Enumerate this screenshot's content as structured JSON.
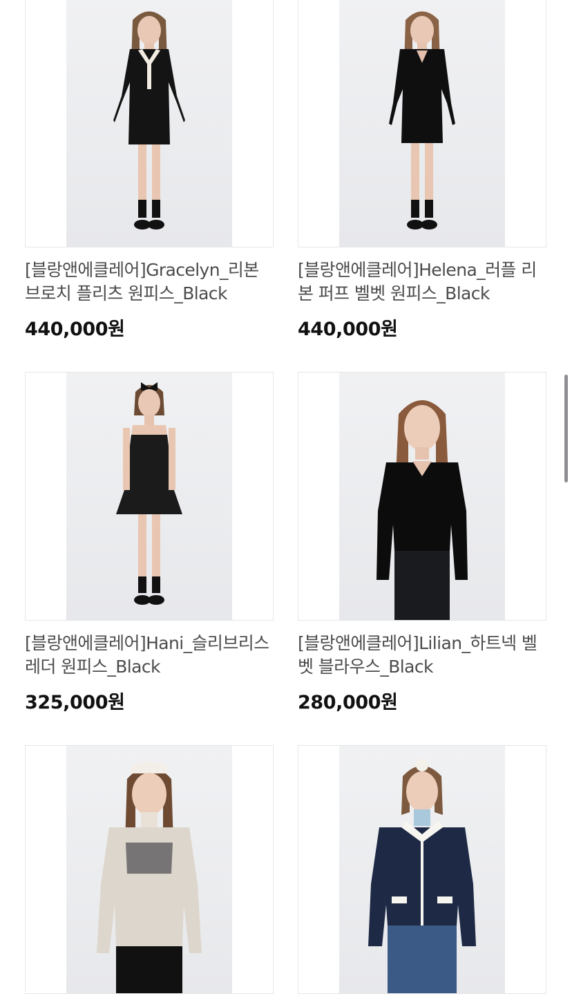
{
  "products": [
    {
      "name": "[블랑앤에클레어]Gracelyn_리본 브로치 플리츠 원피스_Black",
      "price": "440,000원",
      "image": "model-black-pleated-dress-with-ribbon-brooch"
    },
    {
      "name": "[블랑앤에클레어]Helena_러플 리본 퍼프 벨벳 원피스_Black",
      "price": "440,000원",
      "image": "model-black-velvet-puff-dress"
    },
    {
      "name": "[블랑앤에클레어]Hani_슬리브리스 레더 원피스_Black",
      "price": "325,000원",
      "image": "model-black-sleeveless-leather-dress"
    },
    {
      "name": "[블랑앤에클레어]Lilian_하트넥 벨벳 블라우스_Black",
      "price": "280,000원",
      "image": "model-black-heart-neck-velvet-blouse"
    },
    {
      "name": "",
      "price": "",
      "image": "model-sheer-lace-blouse"
    },
    {
      "name": "",
      "price": "",
      "image": "model-navy-quilted-jacket"
    }
  ],
  "colors": {
    "text": "#4b4b4b",
    "price": "#111111",
    "border": "#e6e6e6",
    "scrollbar": "#8e8e93"
  }
}
